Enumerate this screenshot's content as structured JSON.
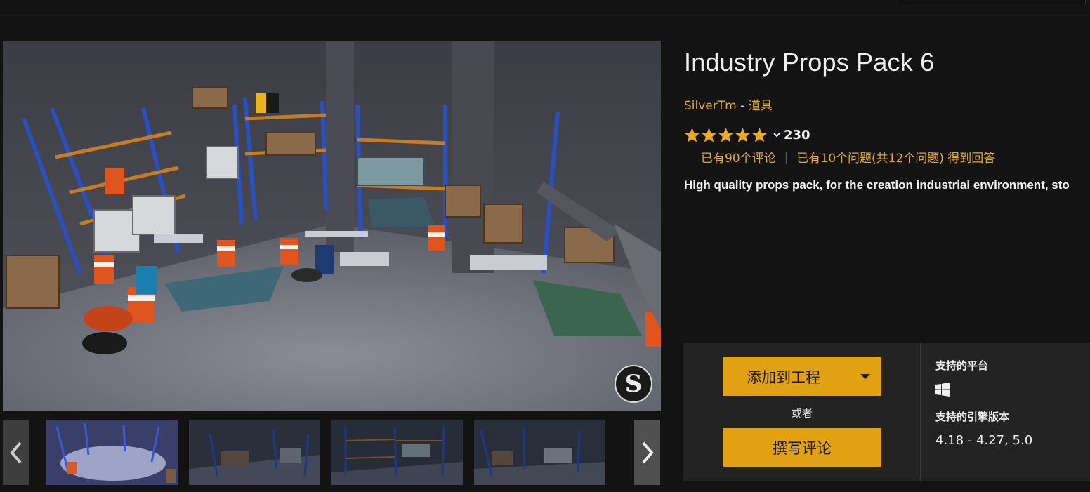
{
  "product": {
    "title": "Industry Props Pack 6",
    "seller": "SilverTm",
    "separator": " - ",
    "category": "道具",
    "rating_count": "230",
    "rating_stars": 5,
    "reviews_link": "已有90个评论",
    "questions_link": "已有10个问题(共12个问题) 得到回答",
    "description": "High quality props pack, for the creation industrial environment, sto"
  },
  "purchase": {
    "add_to_project": "添加到工程",
    "or": "或者",
    "write_review": "撰写评论"
  },
  "support": {
    "platform_heading": "支持的平台",
    "platform_icon": "windows-icon",
    "engine_heading": "支持的引擎版本",
    "engine_versions": "4.18 - 4.27, 5.0"
  },
  "gallery": {
    "logo_letter": "S",
    "thumbnail_count": 4,
    "prev_icon": "chevron-left-icon",
    "next_icon": "chevron-right-icon"
  },
  "colors": {
    "accent": "#e0a113",
    "link": "#e8a923",
    "background": "#131313",
    "panel": "#232323"
  }
}
